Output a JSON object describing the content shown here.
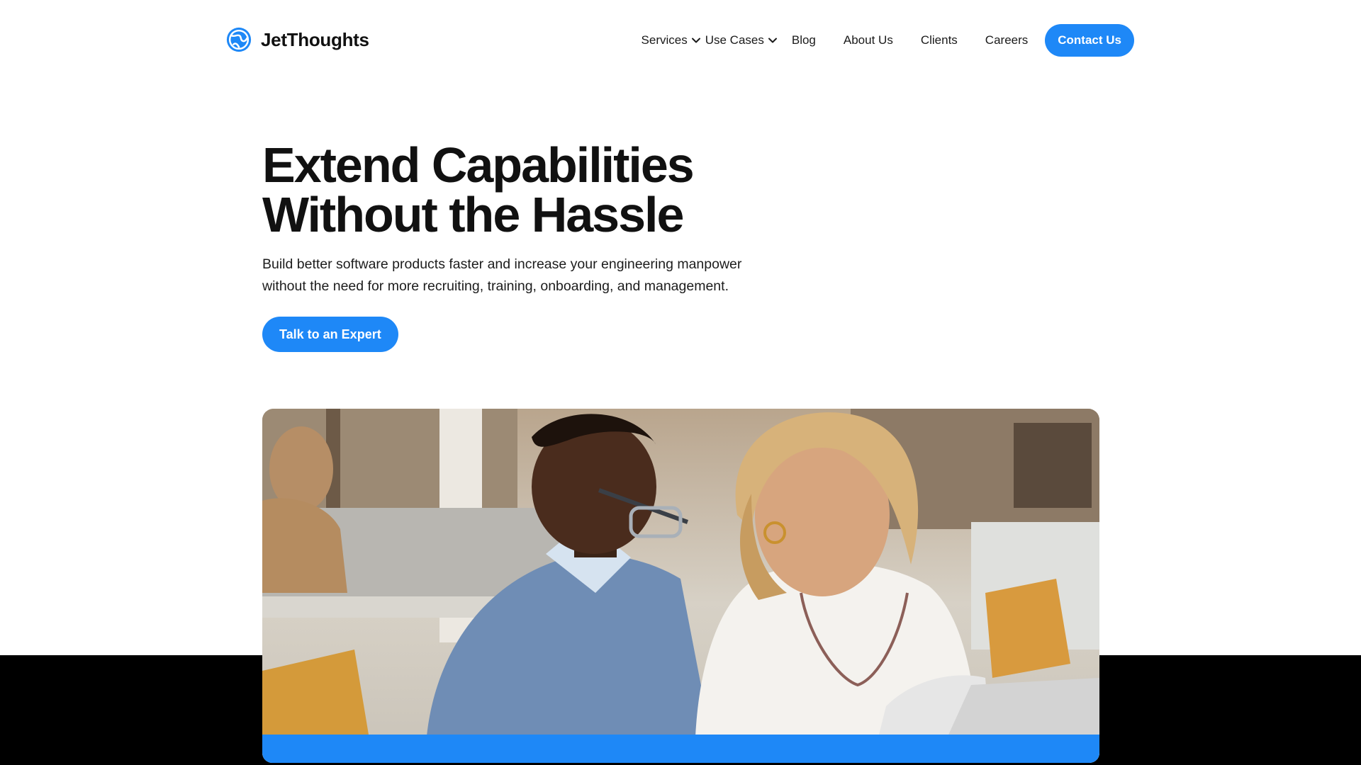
{
  "brand": {
    "name": "JetThoughts",
    "logo_icon": "globe-logo-icon",
    "accent": "#1e88f7"
  },
  "nav": {
    "items": [
      {
        "label": "Services",
        "has_dropdown": true
      },
      {
        "label": "Use Cases",
        "has_dropdown": true
      },
      {
        "label": "Blog",
        "has_dropdown": false
      },
      {
        "label": "About Us",
        "has_dropdown": false
      },
      {
        "label": "Clients",
        "has_dropdown": false
      },
      {
        "label": "Careers",
        "has_dropdown": false
      }
    ],
    "contact_label": "Contact Us"
  },
  "hero": {
    "title_line1": "Extend Capabilities",
    "title_line2": "Without the Hassle",
    "subtitle_line1": "Build better software products faster and increase your engineering manpower",
    "subtitle_line2": "without the need for more recruiting, training, onboarding, and management.",
    "cta_label": "Talk to an Expert"
  },
  "colors": {
    "primary": "#1e88f7",
    "text": "#111111",
    "band": "#000000"
  }
}
